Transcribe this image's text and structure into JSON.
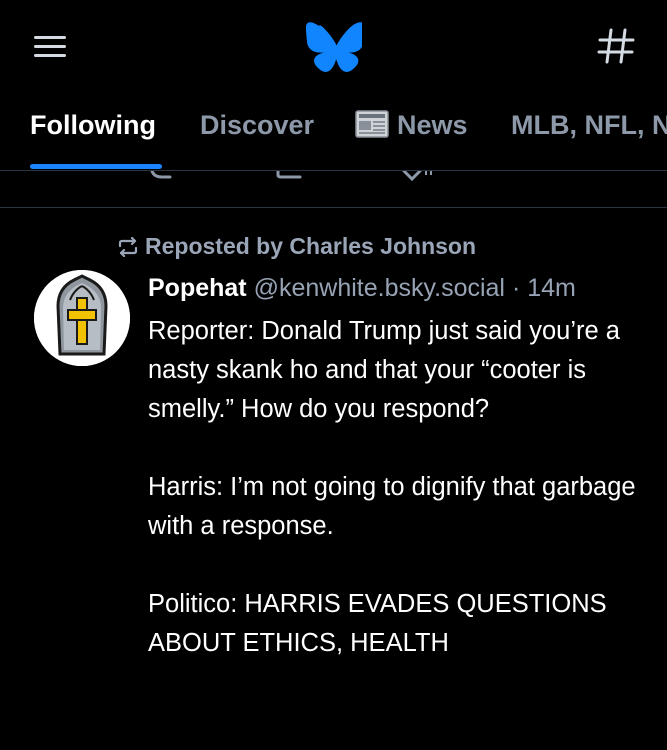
{
  "colors": {
    "background": "#000000",
    "accent": "#1a85ff",
    "muted_text": "#8d98a8",
    "divider": "#2a3442"
  },
  "topbar": {
    "menu_icon": "hamburger-menu-icon",
    "logo_icon": "butterfly-logo-icon",
    "feeds_icon": "hashtag-icon"
  },
  "tabs": [
    {
      "label": "Following",
      "active": true
    },
    {
      "label": "Discover",
      "active": false
    },
    {
      "label": "News",
      "icon": "newspaper-icon",
      "active": false
    },
    {
      "label": "MLB, NFL, N",
      "active": false
    }
  ],
  "post": {
    "repost_label": "Reposted by Charles Johnson",
    "author": {
      "display_name": "Popehat",
      "handle": "@kenwhite.bsky.social",
      "separator": "·",
      "timestamp": "14m"
    },
    "body": [
      "Reporter:  Donald Trump just said you’re a nasty skank ho and that your “cooter is smelly.”  How do you respond?",
      "Harris:  I’m not going to dignify that garbage with a response.",
      "Politico:  HARRIS EVADES QUESTIONS ABOUT ETHICS, HEALTH"
    ]
  }
}
